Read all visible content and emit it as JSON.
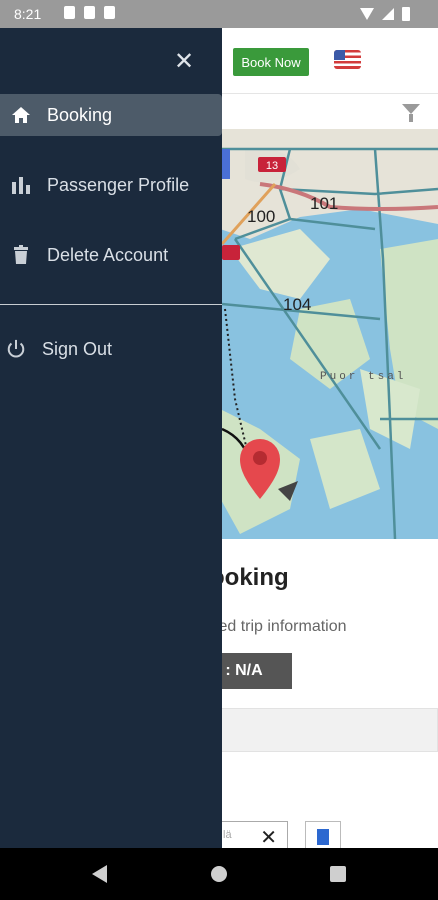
{
  "status_bar": {
    "time": "8:21"
  },
  "header": {
    "book_now_label": "Book Now",
    "flag_icon": "us-flag-icon"
  },
  "map": {
    "labels": [
      "13",
      "100",
      "101",
      "104",
      "Puor tsal"
    ],
    "marker_icon": "location-pin-icon"
  },
  "main": {
    "title": "ooking",
    "subtitle": "ted trip information",
    "status_text": "s : N/A",
    "bottom_input_value": "lä"
  },
  "drawer": {
    "close_icon": "close-icon",
    "items": [
      {
        "label": "Booking",
        "icon": "home-icon",
        "active": true
      },
      {
        "label": "Passenger Profile",
        "icon": "bar-chart-icon",
        "active": false
      },
      {
        "label": "Delete Account",
        "icon": "trash-icon",
        "active": false
      }
    ],
    "sign_out": {
      "label": "Sign Out",
      "icon": "power-icon"
    }
  },
  "nav_bar": {
    "back_icon": "back-icon",
    "home_icon": "home-circle-icon",
    "recents_icon": "recents-icon"
  }
}
